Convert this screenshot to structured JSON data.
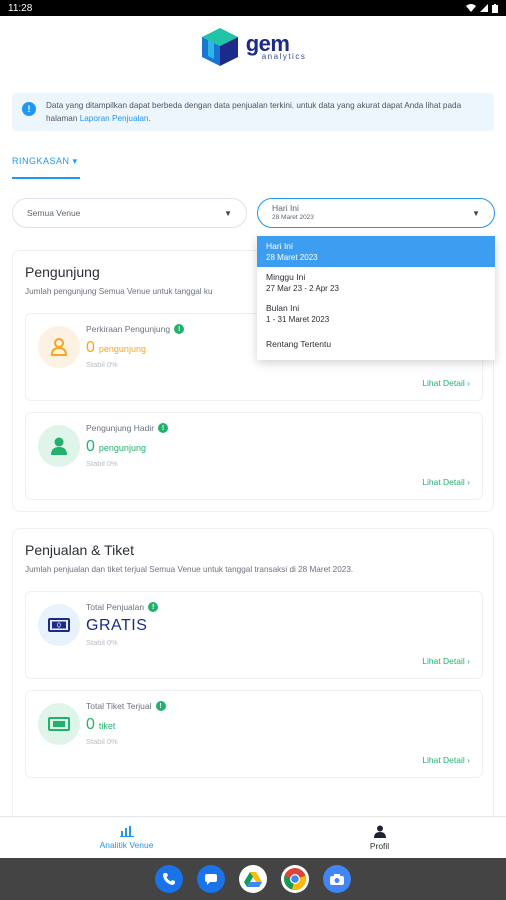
{
  "status": {
    "time": "11:28"
  },
  "brand": {
    "name": "gem",
    "sub": "analytics"
  },
  "info": {
    "text": "Data yang ditampilkan dapat berbeda dengan data penjualan terkini. untuk data yang akurat dapat Anda lihat pada halaman ",
    "link": "Laporan Penjualan",
    "end": "."
  },
  "tab": {
    "label": "RINGKASAN"
  },
  "filters": {
    "venue": "Semua Venue",
    "date_label": "Hari Ini",
    "date_sub": "28 Maret 2023"
  },
  "dropdown": [
    {
      "label": "Hari Ini",
      "sub": "28 Maret 2023"
    },
    {
      "label": "Minggu Ini",
      "sub": "27 Mar 23 - 2 Apr 23"
    },
    {
      "label": "Bulan Ini",
      "sub": "1 - 31 Maret 2023"
    },
    {
      "label": "Rentang Tertentu",
      "sub": ""
    }
  ],
  "visitors": {
    "title": "Pengunjung",
    "desc": "Jumlah pengunjung Semua Venue untuk tanggal ku",
    "metrics": [
      {
        "label": "Perkiraan Pengunjung",
        "value": "0",
        "unit": "pengunjung",
        "stable": "Stabil 0%",
        "link": "Lihat Detail"
      },
      {
        "label": "Pengunjung Hadir",
        "value": "0",
        "unit": "pengunjung",
        "stable": "Stabil 0%",
        "link": "Lihat Detail"
      }
    ]
  },
  "sales": {
    "title": "Penjualan & Tiket",
    "desc": "Jumlah penjualan dan tiket terjual Semua Venue untuk tanggal transaksi di 28 Maret 2023.",
    "metrics": [
      {
        "label": "Total Penjualan",
        "value": "GRATIS",
        "unit": "",
        "stable": "Stabil 0%",
        "link": "Lihat Detail"
      },
      {
        "label": "Total Tiket Terjual",
        "value": "0",
        "unit": "tiket",
        "stable": "Stabil 0%",
        "link": "Lihat Detail"
      }
    ]
  },
  "nav": [
    {
      "label": "Analitik Venue",
      "icon": "bar-chart-icon"
    },
    {
      "label": "Profil",
      "icon": "person-icon"
    }
  ],
  "colors": {
    "primary": "#2196f3",
    "green": "#20b26b",
    "orange": "#f5a623",
    "navy": "#1c2a8a"
  }
}
